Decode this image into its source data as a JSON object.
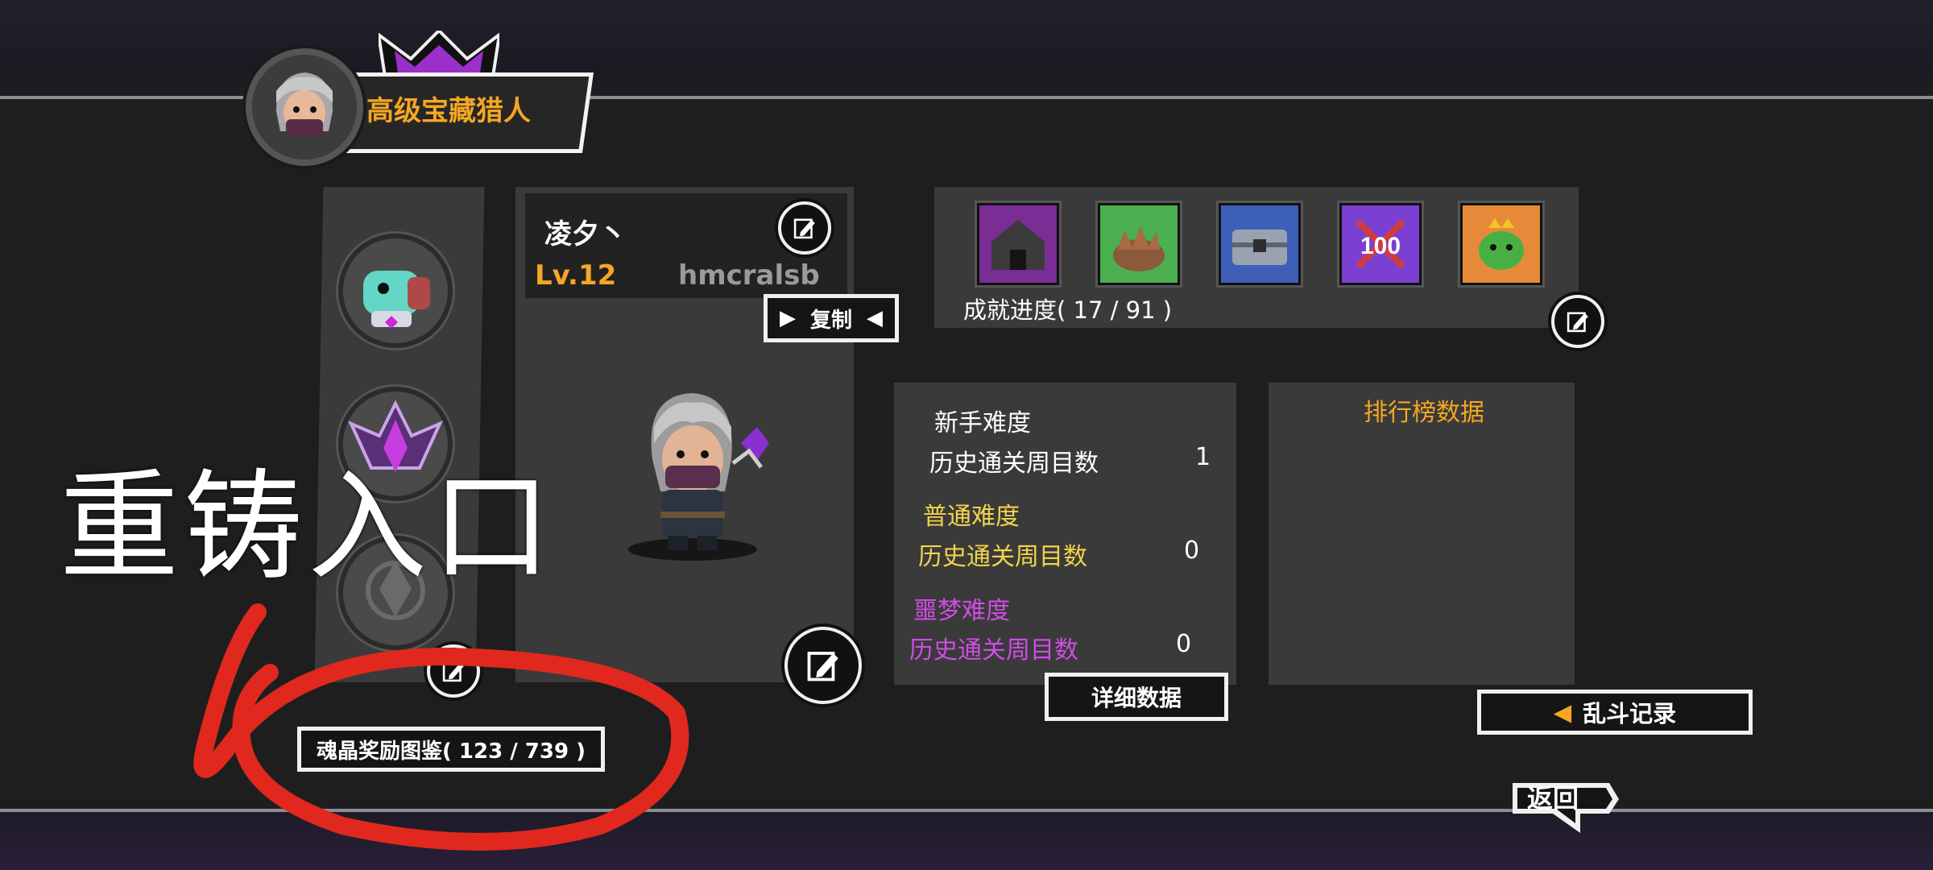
{
  "header": {
    "rank_title": "高级宝藏猎人"
  },
  "profile": {
    "nickname": "凌夕丶",
    "level": "Lv.12",
    "player_id": "hmcralsb",
    "copy_label": "复制"
  },
  "achievements": {
    "progress_label": "成就进度( 17 / 91 )",
    "icons": [
      "temple-icon",
      "nest-icon",
      "chest-icon",
      "100-badge-icon",
      "goblin-king-icon"
    ]
  },
  "stats": {
    "novice": {
      "title": "新手难度",
      "label": "历史通关周目数",
      "value": "1"
    },
    "normal": {
      "title": "普通难度",
      "label": "历史通关周目数",
      "value": "0"
    },
    "nightmare": {
      "title": "噩梦难度",
      "label": "历史通关周目数",
      "value": "0"
    },
    "detail_button": "详细数据"
  },
  "leaderboard": {
    "title": "排行榜数据"
  },
  "brawl_button": "乱斗记录",
  "soul_crystal_label": "魂晶奖励图鉴( 123 / 739 )",
  "back_button": "返回",
  "annotation": {
    "text": "重铸入口"
  },
  "colors": {
    "orange": "#f5a623",
    "yellow": "#f2d34b",
    "purple": "#d04ce6",
    "annotation_red": "#e0281e"
  }
}
